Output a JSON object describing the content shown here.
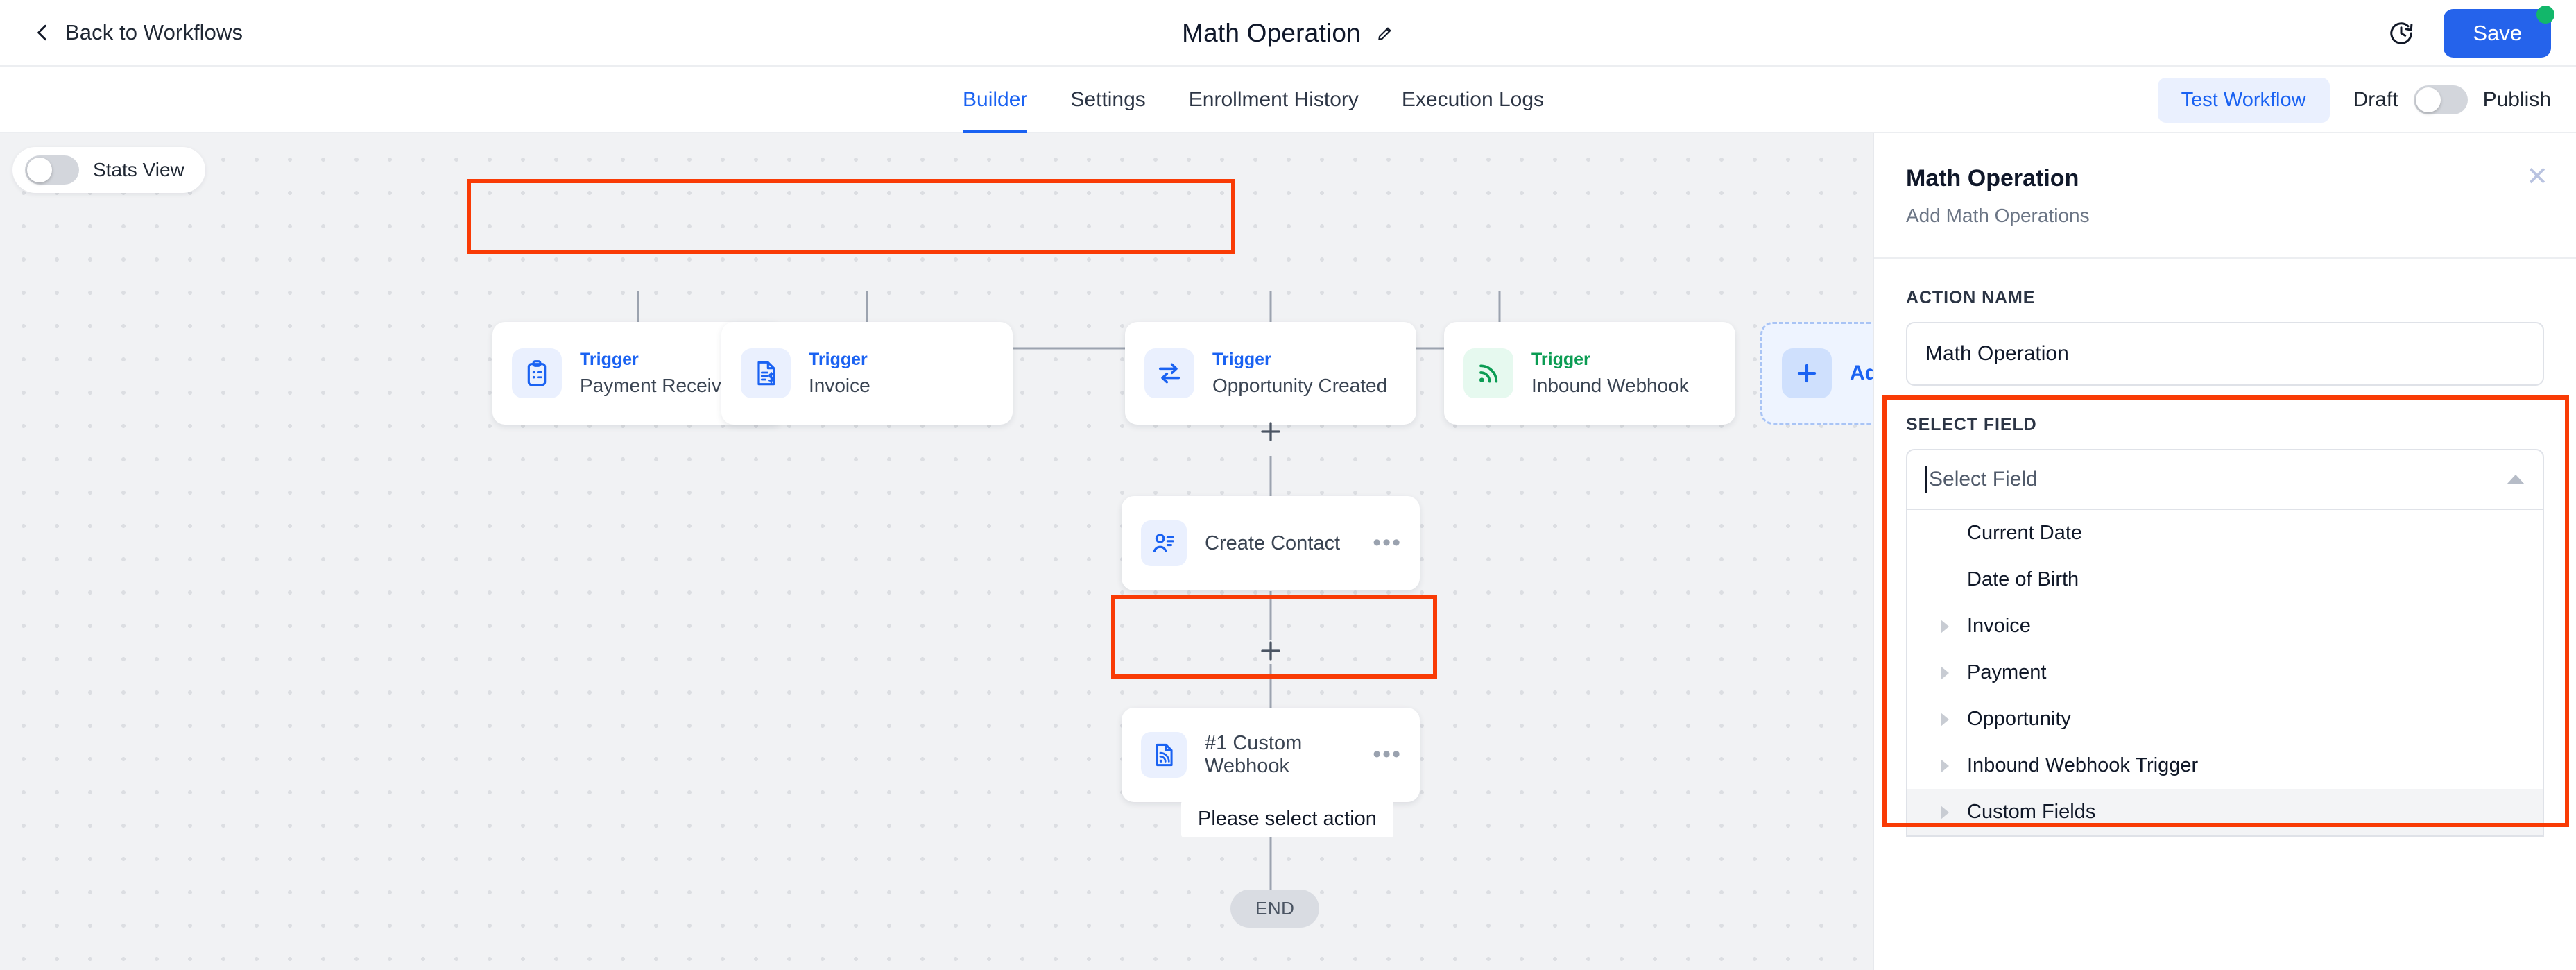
{
  "topbar": {
    "back_label": "Back to Workflows",
    "title": "Math Operation",
    "edit_icon": "pencil-icon",
    "history_icon": "history-clock-icon",
    "save_label": "Save"
  },
  "tabsbar": {
    "tabs": [
      {
        "label": "Builder",
        "active": true
      },
      {
        "label": "Settings",
        "active": false
      },
      {
        "label": "Enrollment History",
        "active": false
      },
      {
        "label": "Execution Logs",
        "active": false
      }
    ],
    "test_label": "Test Workflow",
    "draft_label": "Draft",
    "publish_label": "Publish"
  },
  "canvas": {
    "stats_toggle_label": "Stats View",
    "triggers": [
      {
        "kind": "Trigger",
        "name": "Payment Received",
        "icon": "clipboard-icon",
        "accent": "blue"
      },
      {
        "kind": "Trigger",
        "name": "Invoice",
        "icon": "invoice-document-icon",
        "accent": "blue"
      },
      {
        "kind": "Trigger",
        "name": "Opportunity Created",
        "icon": "arrows-exchange-icon",
        "accent": "blue"
      },
      {
        "kind": "Trigger",
        "name": "Inbound Webhook",
        "icon": "rss-signal-icon",
        "accent": "green"
      }
    ],
    "add_new_label": "Add N",
    "add_new_icon": "plus-icon",
    "nodes": [
      {
        "label": "Create Contact",
        "icon": "person-list-icon",
        "menu": "•••"
      },
      {
        "label": "#1 Custom Webhook",
        "icon": "document-rss-icon",
        "menu": "•••"
      }
    ],
    "note": "Please select action",
    "end_label": "END"
  },
  "panel": {
    "title": "Math Operation",
    "subtitle": "Add Math Operations",
    "close_icon": "close-icon",
    "action_name_label": "ACTION NAME",
    "action_name_value": "Math Operation",
    "select_field_label": "SELECT FIELD",
    "select_field_placeholder": "Select Field",
    "options": [
      {
        "label": "Current Date",
        "expandable": false,
        "highlighted": false
      },
      {
        "label": "Date of Birth",
        "expandable": false,
        "highlighted": false
      },
      {
        "label": "Invoice",
        "expandable": true,
        "highlighted": false
      },
      {
        "label": "Payment",
        "expandable": true,
        "highlighted": false
      },
      {
        "label": "Opportunity",
        "expandable": true,
        "highlighted": false
      },
      {
        "label": "Inbound Webhook Trigger",
        "expandable": true,
        "highlighted": false
      },
      {
        "label": "Custom Fields",
        "expandable": true,
        "highlighted": true
      }
    ]
  },
  "colors": {
    "accent_blue": "#1a62f2",
    "save_blue": "#2563eb",
    "green": "#0b9c53",
    "annotation_red": "#f93b05",
    "canvas_bg": "#f1f2f4"
  }
}
